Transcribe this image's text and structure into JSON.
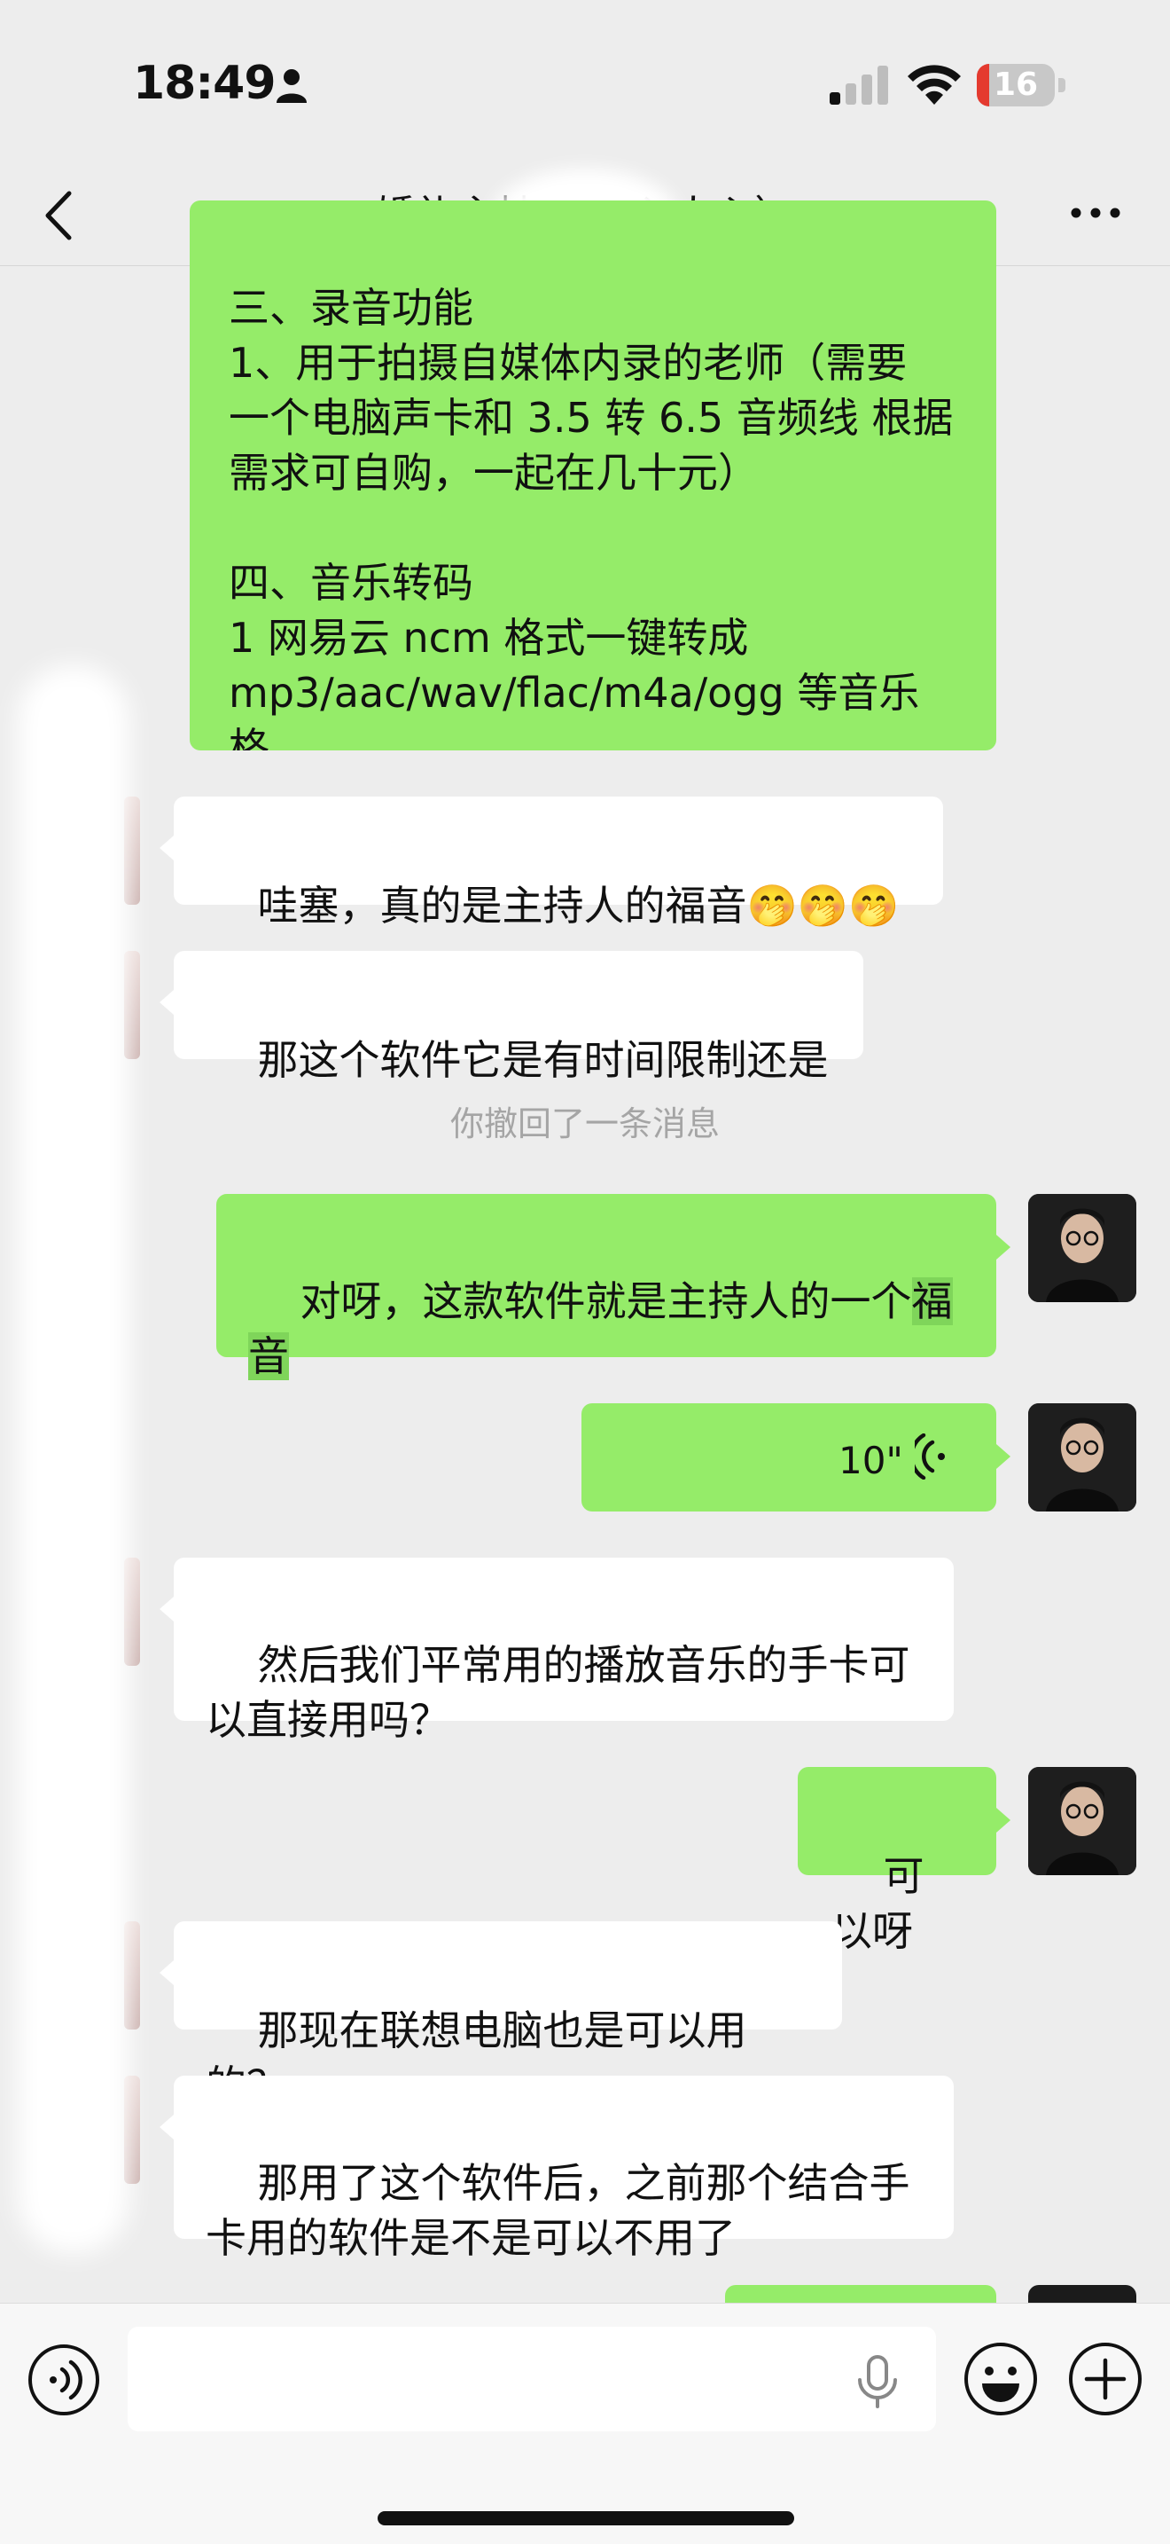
{
  "status_bar": {
    "time": "18:49",
    "battery_level": "16",
    "battery_fraction": 0.16,
    "battery_color": "#e43a2f"
  },
  "nav": {
    "title": "婚礼主持人               声入人心）"
  },
  "messages": {
    "m1": {
      "lines": "三、录音功能\n1、用于拍摄自媒体内录的老师（需要\n一个电脑声卡和 3.5 转 6.5 音频线 根据\n需求可自购，一起在几十元）\n\n四、音乐转码\n1 网易云 ncm 格式一键转成\nmp3/aac/wav/flac/m4a/ogg 等音乐格\n式"
    },
    "m2": {
      "text": "哇塞，真的是主持人的福音🤭🤭🤭"
    },
    "m3": {
      "text": "那这个软件它是有时间限制还是"
    },
    "system": {
      "text": "你撤回了一条消息"
    },
    "m4": {
      "line1_a": "对呀，这款软件就是主持人的一个",
      "line1_b": "福",
      "line2": "音"
    },
    "m5": {
      "duration": "10\""
    },
    "m6": {
      "text": "然后我们平常用的播放音乐的手卡可\n以直接用吗？"
    },
    "m7": {
      "text": "可以呀"
    },
    "m8": {
      "text": "那现在联想电脑也是可以用的？"
    },
    "m9": {
      "text": "那用了这个软件后，之前那个结合手\n卡用的软件是不是可以不用了"
    }
  },
  "input_bar": {
    "placeholder": ""
  },
  "colors": {
    "bubble_self": "#95ec69",
    "bubble_other": "#ffffff",
    "background": "#ededed"
  }
}
